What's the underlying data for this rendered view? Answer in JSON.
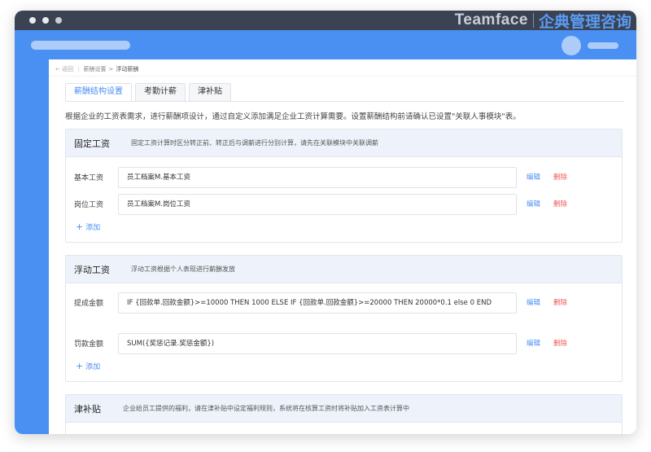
{
  "brand": {
    "name_en": "Teamface",
    "name_cn": "企典管理咨询"
  },
  "breadcrumb": {
    "back": "← 返回",
    "parent": "薪酬设置",
    "sep": ">",
    "current": "浮动薪酬"
  },
  "tabs": [
    {
      "label": "薪酬结构设置",
      "active": true
    },
    {
      "label": "考勤计薪",
      "active": false
    },
    {
      "label": "津补贴",
      "active": false
    }
  ],
  "description": "根据企业的工资表需求，进行薪酬项设计，通过自定义添加满足企业工资计算需要。设置薪酬结构前请确认已设置\"关联人事模块\"表。",
  "actions": {
    "edit": "编辑",
    "delete": "删除",
    "add": "添加"
  },
  "sections": {
    "fixed": {
      "title": "固定工资",
      "hint": "固定工资计算时区分转正前、转正后与调薪进行分别计算，请先在关联模块中关联调薪",
      "rows": [
        {
          "label": "基本工资",
          "value": "员工档案M.基本工资"
        },
        {
          "label": "岗位工资",
          "value": "员工档案M.岗位工资"
        }
      ]
    },
    "floating": {
      "title": "浮动工资",
      "hint": "浮动工资根据个人表现进行薪酬发放",
      "rows": [
        {
          "label": "提成金额",
          "value": "IF {回款单.回款金额}>=10000 THEN 1000 ELSE IF {回款单.回款金额}>=20000 THEN 20000*0.1 else 0 END"
        },
        {
          "label": "罚款金额",
          "value": "SUM({奖惩记录.奖惩金额})"
        }
      ]
    },
    "allowance": {
      "title": "津补贴",
      "hint": "企业给员工提供的福利，请在津补贴中设定福利规则，系统将在核算工资时将补贴加入工资表计算中"
    }
  },
  "colors": {
    "accent": "#4a8ff2",
    "danger": "#f05656",
    "titlebar": "#3b4252",
    "section_head": "#eef3fb"
  }
}
